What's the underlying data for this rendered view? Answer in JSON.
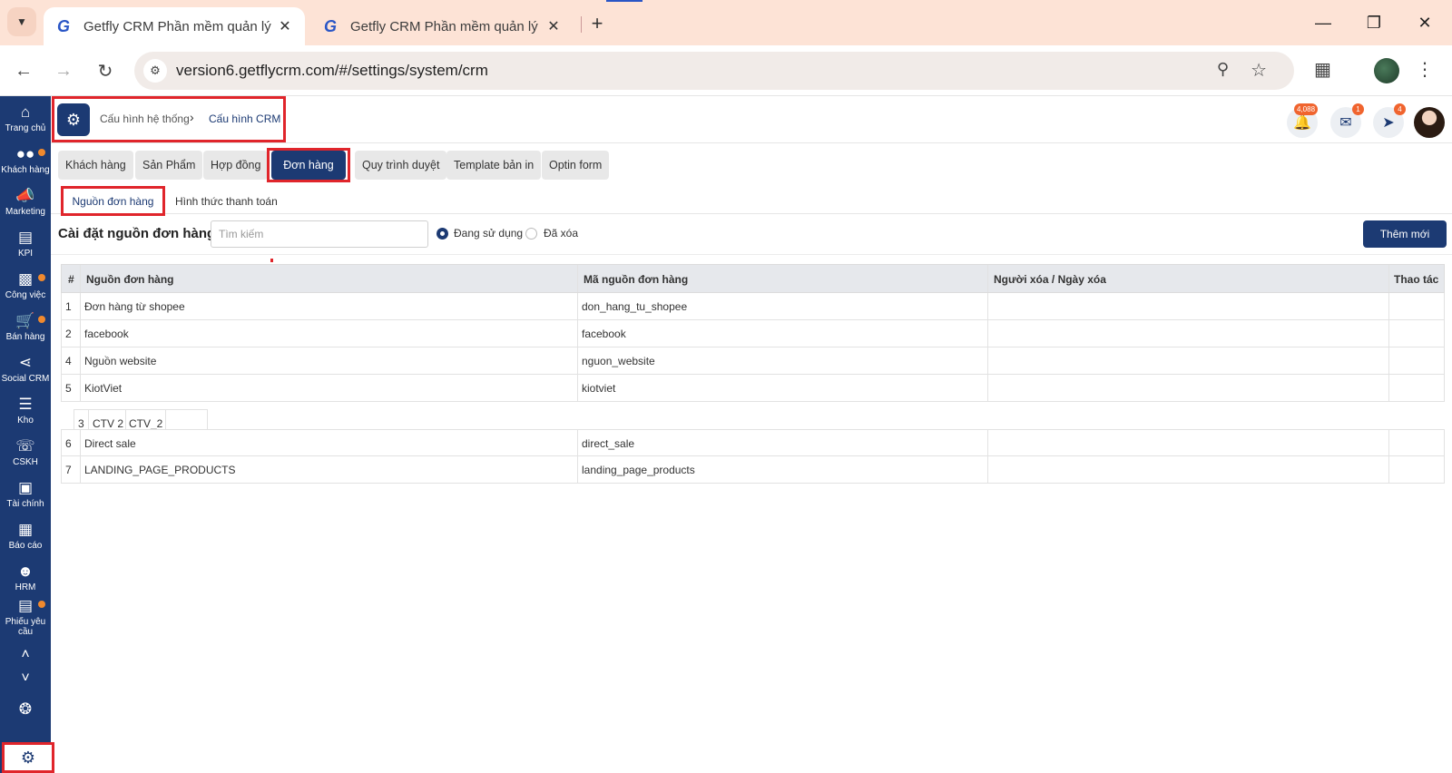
{
  "browser": {
    "tabs": [
      {
        "title": "Getfly CRM Phần mềm quản lý",
        "active": true
      },
      {
        "title": "Getfly CRM Phần mềm quản lý",
        "active": false
      }
    ],
    "url": "version6.getflycrm.com/#/settings/system/crm",
    "icons": {
      "favicon": "G"
    }
  },
  "sidebar": {
    "items": [
      {
        "label": "Trang chủ",
        "icon": "home-icon",
        "dot": false
      },
      {
        "label": "Khách hàng",
        "icon": "people-icon",
        "dot": true
      },
      {
        "label": "Marketing",
        "icon": "megaphone-icon",
        "dot": false
      },
      {
        "label": "KPI",
        "icon": "chart-icon",
        "dot": false
      },
      {
        "label": "Công việc",
        "icon": "briefcase-icon",
        "dot": true
      },
      {
        "label": "Bán hàng",
        "icon": "cart-icon",
        "dot": true
      },
      {
        "label": "Social CRM",
        "icon": "share-icon",
        "dot": false
      },
      {
        "label": "Kho",
        "icon": "warehouse-icon",
        "dot": false
      },
      {
        "label": "CSKH",
        "icon": "phone-icon",
        "dot": false
      },
      {
        "label": "Tài chính",
        "icon": "finance-icon",
        "dot": false
      },
      {
        "label": "Báo cáo",
        "icon": "report-icon",
        "dot": false
      },
      {
        "label": "HRM",
        "icon": "badge-icon",
        "dot": false
      },
      {
        "label": "Phiếu yêu cầu",
        "icon": "ticket-icon",
        "dot": true
      }
    ]
  },
  "header": {
    "breadcrumb": {
      "parent": "Cấu hình hệ thống",
      "current": "Cấu hình CRM"
    },
    "notifications": {
      "bell": "4,088",
      "chat": "1",
      "rocket": "4"
    }
  },
  "module_tabs": [
    {
      "label": "Khách hàng",
      "active": false
    },
    {
      "label": "Sản Phẩm",
      "active": false
    },
    {
      "label": "Hợp đồng",
      "active": false
    },
    {
      "label": "Đơn hàng",
      "active": true
    },
    {
      "label": "Quy trình duyệt",
      "active": false
    },
    {
      "label": "Template bản in",
      "active": false
    },
    {
      "label": "Optin form",
      "active": false
    }
  ],
  "sub_tabs": [
    {
      "label": "Nguồn đơn hàng",
      "active": true
    },
    {
      "label": "Hình thức thanh toán",
      "active": false
    }
  ],
  "settings": {
    "title": "Cài đặt nguồn đơn hàng",
    "search_placeholder": "Tìm kiếm",
    "filter_options": [
      {
        "label": "Đang sử dụng",
        "checked": true
      },
      {
        "label": "Đã xóa",
        "checked": false
      }
    ],
    "add_button": "Thêm mới"
  },
  "table": {
    "columns": [
      "#",
      "Nguồn đơn hàng",
      "Mã nguồn đơn hàng",
      "Người xóa / Ngày xóa",
      "Thao tác"
    ],
    "rows": [
      {
        "id": "1",
        "name": "Đơn hàng từ shopee",
        "code": "don_hang_tu_shopee"
      },
      {
        "id": "2",
        "name": "facebook",
        "code": "facebook"
      },
      {
        "id": "4",
        "name": "Nguồn website",
        "code": "nguon_website"
      },
      {
        "id": "5",
        "name": "KiotViet",
        "code": "kiotviet"
      },
      {
        "id": "6",
        "name": "Direct sale",
        "code": "direct_sale"
      },
      {
        "id": "7",
        "name": "LANDING_PAGE_PRODUCTS",
        "code": "landing_page_products"
      }
    ],
    "dragged_row": {
      "id": "3",
      "name": "CTV 2",
      "code": "CTV_2"
    }
  }
}
